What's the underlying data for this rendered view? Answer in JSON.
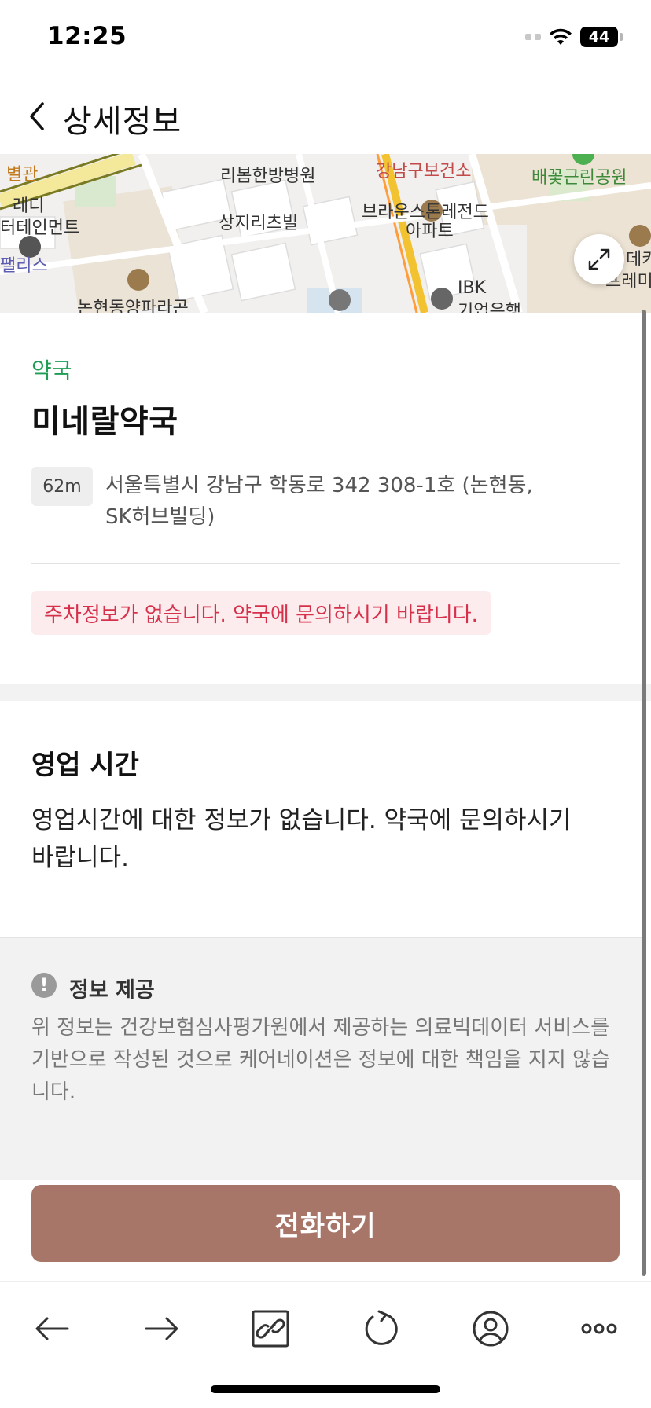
{
  "status_bar": {
    "time": "12:25",
    "battery": "44"
  },
  "header": {
    "back_icon": "chevron-left-icon",
    "title": "상세정보"
  },
  "map": {
    "labels": [
      "별관",
      "레디",
      "터테인먼트",
      "리봄한방병원",
      "강남구보건소",
      "배꽃근린공원",
      "상지리츠빌",
      "브라운스톤레전드",
      "아파트",
      "IBK",
      "기업은행",
      "팰리스",
      "논현동양파라곤",
      "데카",
      "프레미어"
    ],
    "expand_icon": "expand-icon"
  },
  "place": {
    "category": "약국",
    "name": "미네랄약국",
    "distance": "62m",
    "address": "서울특별시 강남구 학동로 342 308-1호 (논현동, SK허브빌딩)",
    "parking_notice": "주차정보가 없습니다. 약국에 문의하시기 바랍니다."
  },
  "hours": {
    "title": "영업 시간",
    "text": "영업시간에 대한 정보가 없습니다. 약국에 문의하시기 바랍니다."
  },
  "info": {
    "icon": "exclamation-icon",
    "title": "정보 제공",
    "text": "위 정보는 건강보험심사평가원에서 제공하는 의료빅데이터 서비스를 기반으로 작성된 것으로 케어네이션은 정보에 대한 책임을 지지 않습니다."
  },
  "call_button": {
    "label": "전화하기"
  },
  "bottom_bar": {
    "items": [
      "back-arrow-icon",
      "forward-arrow-icon",
      "link-icon",
      "refresh-icon",
      "profile-icon",
      "more-icon"
    ]
  },
  "colors": {
    "accent_green": "#1f9d55",
    "notice_red": "#d6314b",
    "call_button": "#a87668"
  }
}
